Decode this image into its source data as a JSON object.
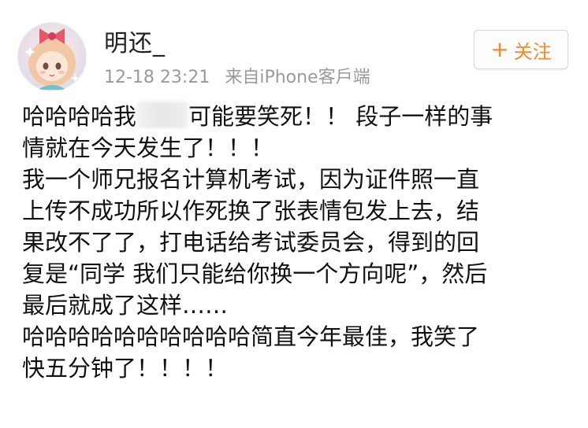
{
  "user": {
    "name": "明还_",
    "avatar_icon": "anime-girl-avatar-icon"
  },
  "meta": {
    "time": "12-18 23:21",
    "source": "来自iPhone客戶端"
  },
  "follow_button": {
    "plus": "+",
    "label": "关注",
    "color": "#f28a2e"
  },
  "post": {
    "line1_before": "哈哈哈哈我",
    "line1_after": "可能要笑死！！ 段子一样的事",
    "line2": "情就在今天发生了！！！",
    "line3": "我一个师兄报名计算机考试，因为证件照一直",
    "line4": "上传不成功所以作死换了张表情包发上去，结",
    "line5": "果改不了了，打电话给考试委员会，得到的回",
    "line6": "复是“同学 我们只能给你换一个方向呢”，然后",
    "line7": "最后就成了这样……",
    "line8": "哈哈哈哈哈哈哈哈哈哈简直今年最佳，我笑了",
    "line9": "快五分钟了！！！！"
  }
}
